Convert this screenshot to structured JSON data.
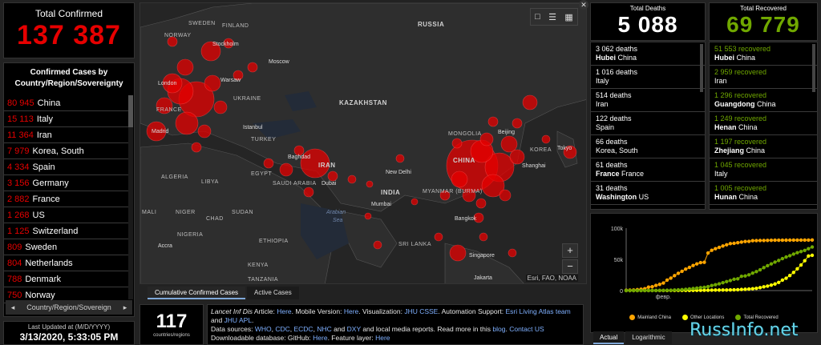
{
  "total_confirmed": {
    "label": "Total Confirmed",
    "value": "137 387"
  },
  "country_list": {
    "header": "Confirmed Cases by Country/Region/Sovereignty",
    "items": [
      {
        "count": "80 945",
        "name": "China"
      },
      {
        "count": "15 113",
        "name": "Italy"
      },
      {
        "count": "11 364",
        "name": "Iran"
      },
      {
        "count": "7 979",
        "name": "Korea, South"
      },
      {
        "count": "4 334",
        "name": "Spain"
      },
      {
        "count": "3 156",
        "name": "Germany"
      },
      {
        "count": "2 882",
        "name": "France"
      },
      {
        "count": "1 268",
        "name": "US"
      },
      {
        "count": "1 125",
        "name": "Switzerland"
      },
      {
        "count": "809",
        "name": "Sweden"
      },
      {
        "count": "804",
        "name": "Netherlands"
      },
      {
        "count": "788",
        "name": "Denmark"
      },
      {
        "count": "750",
        "name": "Norway"
      }
    ],
    "nav_label": "Country/Region/Sovereign",
    "nav_prev": "◂",
    "nav_next": "▸"
  },
  "last_updated": {
    "label": "Last Updated at (M/D/YYYY)",
    "value": "3/13/2020, 5:33:05 PM"
  },
  "map": {
    "labels": {
      "sweden": "SWEDEN",
      "finland": "FINLAND",
      "norway": "NORWAY",
      "russia": "RUSSIA",
      "stockholm": "Stockholm",
      "moscow": "Moscow",
      "ukraine": "UKRAINE",
      "kazakhstan": "KAZAKHSTAN",
      "warsaw": "Warsaw",
      "london": "London",
      "france": "FRANCE",
      "madrid": "Madrid",
      "istanbul": "Istanbul",
      "turkey": "TURKEY",
      "baghdad": "Baghdad",
      "iran": "IRAN",
      "egypt": "EGYPT",
      "saudi": "SAUDI ARABIA",
      "dubai": "Dubai",
      "algeria": "ALGERIA",
      "libya": "LIBYA",
      "newdelhi": "New Delhi",
      "india": "INDIA",
      "china": "CHINA",
      "mongolia": "MONGOLIA",
      "myanmar": "MYANMAR (BURMA)",
      "mumbai": "Mumbai",
      "arabian": "Arabian",
      "sea": "Sea",
      "mali": "MALI",
      "niger": "NIGER",
      "chad": "CHAD",
      "sudan": "SUDAN",
      "ethiopia": "ETHIOPIA",
      "nigeria": "NIGERIA",
      "accra": "Accra",
      "kenya": "KENYA",
      "tanzania": "TANZANIA",
      "singapore": "Singapore",
      "jakarta": "Jakarta",
      "bangkok": "Bangkok",
      "korea": "KOREA",
      "beijing": "Beijing",
      "shanghai": "Shanghai",
      "tokyo": "Tokyo",
      "sri": "SRI LANKA"
    },
    "zoom_in": "+",
    "zoom_out": "−",
    "attribution": "Esri, FAO, NOAA",
    "tools": [
      "bookmark-icon",
      "list-icon",
      "qr-icon"
    ]
  },
  "map_tabs": [
    "Cumulative Confirmed Cases",
    "Active Cases"
  ],
  "countries_regions": {
    "value": "117",
    "label": "countries/regions"
  },
  "info": {
    "line1_pre": "Lancet Inf Dis",
    "line1_a": " Article: ",
    "here1": "Here",
    "line1_b": ". Mobile Version: ",
    "here2": "Here",
    "line1_c": ". Visualization: ",
    "jhu": "JHU CSSE",
    "line1_d": ". Automation Support: ",
    "esri": "Esri Living Atlas team",
    "and1": " and ",
    "apl": "JHU APL",
    "line1_e": ".",
    "sources_pre": "Data sources: ",
    "who": "WHO",
    "c1": ", ",
    "cdc": "CDC",
    "c2": ", ",
    "ecdc": "ECDC",
    "c3": ", ",
    "nhc": "NHC",
    "and2": " and ",
    "dxy": "DXY",
    "sources_post": " and local media reports. Read more in this ",
    "blog": "blog",
    "dot": ". ",
    "contact": "Contact US",
    "line3_pre": "Downloadable database: GitHub: ",
    "here3": "Here",
    "line3_b": ". Feature layer: ",
    "here4": "Here"
  },
  "total_deaths": {
    "label": "Total Deaths",
    "value": "5 088",
    "items": [
      {
        "count": "3 062 deaths",
        "bold": "Hubei",
        "rest": " China"
      },
      {
        "count": "1 016 deaths",
        "bold": "",
        "rest": "Italy"
      },
      {
        "count": "514 deaths",
        "bold": "",
        "rest": "Iran"
      },
      {
        "count": "122 deaths",
        "bold": "",
        "rest": "Spain"
      },
      {
        "count": "66 deaths",
        "bold": "",
        "rest": "Korea, South"
      },
      {
        "count": "61 deaths",
        "bold": "France",
        "rest": " France"
      },
      {
        "count": "31 deaths",
        "bold": "Washington",
        "rest": " US"
      }
    ]
  },
  "total_recovered": {
    "label": "Total Recovered",
    "value": "69 779",
    "items": [
      {
        "count": "51 553 recovered",
        "bold": "Hubei",
        "rest": " China"
      },
      {
        "count": "2 959 recovered",
        "bold": "",
        "rest": "Iran"
      },
      {
        "count": "1 296 recovered",
        "bold": "Guangdong",
        "rest": " China"
      },
      {
        "count": "1 249 recovered",
        "bold": "Henan",
        "rest": " China"
      },
      {
        "count": "1 197 recovered",
        "bold": "Zhejiang",
        "rest": " China"
      },
      {
        "count": "1 045 recovered",
        "bold": "",
        "rest": "Italy"
      },
      {
        "count": "1 005 recovered",
        "bold": "Hunan",
        "rest": " China"
      }
    ]
  },
  "chart_tabs": [
    "Actual",
    "Logarithmic"
  ],
  "watermark": "RussInfo.net",
  "chart_data": {
    "type": "line",
    "title": "",
    "xlabel": "",
    "ylabel": "",
    "ytick_labels": [
      "0",
      "50k",
      "100k"
    ],
    "xtick_labels": [
      "февр."
    ],
    "ylim": [
      0,
      100000
    ],
    "x": [
      0,
      1,
      2,
      3,
      4,
      5,
      6,
      7,
      8,
      9,
      10,
      11,
      12,
      13,
      14,
      15,
      16,
      17,
      18,
      19,
      20,
      21,
      22,
      23,
      24,
      25,
      26,
      27,
      28,
      29,
      30,
      31,
      32,
      33,
      34,
      35,
      36,
      37,
      38,
      39,
      40,
      41,
      42,
      43,
      44,
      45,
      46,
      47,
      48,
      49,
      50
    ],
    "series": [
      {
        "name": "Mainland China",
        "color": "#ffa500",
        "values": [
          555,
          653,
          941,
          1438,
          2118,
          2927,
          5578,
          6165,
          8235,
          9925,
          12038,
          16787,
          19881,
          23892,
          27636,
          30818,
          34392,
          37121,
          40151,
          42763,
          44803,
          45222,
          60106,
          64460,
          67100,
          69187,
          71329,
          73332,
          75198,
          75700,
          76677,
          77673,
          78651,
          78801,
          79826,
          80026,
          80151,
          80271,
          80422,
          80573,
          80652,
          80699,
          80735,
          80757,
          80778,
          80793,
          80813,
          80824,
          80844,
          80860,
          80945
        ]
      },
      {
        "name": "Other Locations",
        "color": "#ffff00",
        "values": [
          0,
          6,
          8,
          15,
          20,
          43,
          58,
          68,
          82,
          106,
          132,
          146,
          153,
          159,
          191,
          216,
          270,
          287,
          319,
          395,
          447,
          505,
          526,
          683,
          794,
          806,
          894,
          918,
          1074,
          1209,
          1402,
          1769,
          2069,
          2459,
          2918,
          3664,
          4691,
          6009,
          7169,
          8774,
          10566,
          13112,
          16787,
          19845,
          24093,
          29061,
          34786,
          40977,
          47826,
          55410,
          56442
        ]
      },
      {
        "name": "Total Recovered",
        "color": "#70a800",
        "values": [
          28,
          30,
          36,
          39,
          52,
          61,
          107,
          126,
          143,
          222,
          284,
          472,
          623,
          852,
          1124,
          1487,
          2011,
          2616,
          3244,
          3946,
          4683,
          5150,
          6295,
          8058,
          9395,
          10865,
          12583,
          14352,
          16121,
          18177,
          18890,
          22886,
          23394,
          25227,
          27905,
          30384,
          33277,
          36711,
          39782,
          42716,
          45602,
          48228,
          51171,
          53797,
          55866,
          58359,
          60694,
          62494,
          64404,
          67003,
          69779
        ]
      }
    ]
  }
}
